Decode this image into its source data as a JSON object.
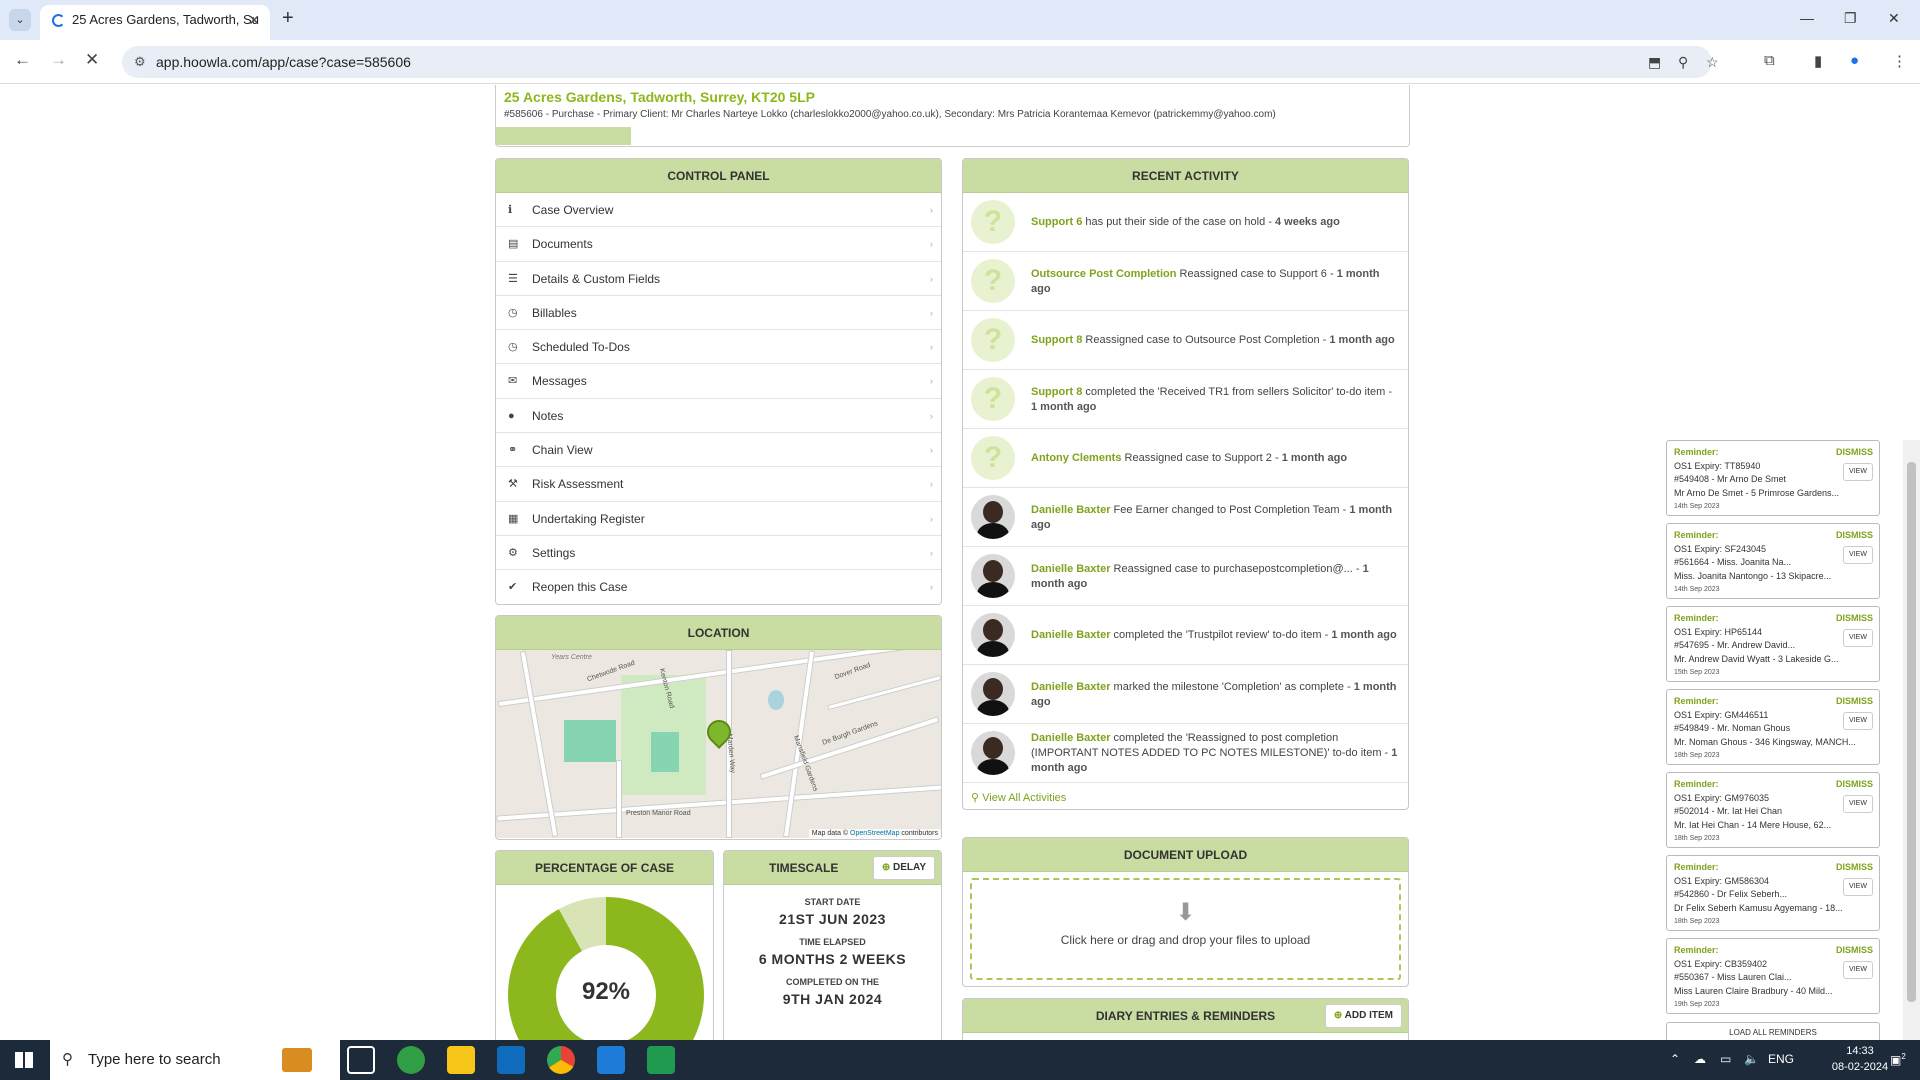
{
  "browser": {
    "tab_title": "25 Acres Gardens, Tadworth, Su",
    "url": "app.hoowla.com/app/case?case=585606"
  },
  "case": {
    "title": "25 Acres Gardens, Tadworth, Surrey, KT20 5LP",
    "subtitle": "#585606 - Purchase - Primary Client: Mr Charles Narteye Lokko (charleslokko2000@yahoo.co.uk), Secondary: Mrs Patricia Korantemaa Kemevor (patrickemmy@yahoo.com)"
  },
  "control_panel": {
    "title": "CONTROL PANEL",
    "items": [
      {
        "label": "Case Overview",
        "icon": "info-icon"
      },
      {
        "label": "Documents",
        "icon": "document-icon"
      },
      {
        "label": "Details & Custom Fields",
        "icon": "list-icon"
      },
      {
        "label": "Billables",
        "icon": "clock-icon"
      },
      {
        "label": "Scheduled To-Dos",
        "icon": "clock-icon"
      },
      {
        "label": "Messages",
        "icon": "envelope-icon"
      },
      {
        "label": "Notes",
        "icon": "comment-icon"
      },
      {
        "label": "Chain View",
        "icon": "link-icon"
      },
      {
        "label": "Risk Assessment",
        "icon": "gavel-icon"
      },
      {
        "label": "Undertaking Register",
        "icon": "register-icon"
      },
      {
        "label": "Settings",
        "icon": "gear-icon"
      },
      {
        "label": "Reopen this Case",
        "icon": "check-icon"
      }
    ]
  },
  "recent_activity": {
    "title": "RECENT ACTIVITY",
    "items": [
      {
        "who": "Support 6",
        "text": " has put their side of the case on hold - ",
        "when": "4 weeks ago",
        "photo": false
      },
      {
        "who": "Outsource Post Completion",
        "text": " Reassigned case to Support 6 - ",
        "when": "1 month ago",
        "photo": false
      },
      {
        "who": "Support 8",
        "text": " Reassigned case to Outsource Post Completion - ",
        "when": "1 month ago",
        "photo": false
      },
      {
        "who": "Support 8",
        "text": " completed the 'Received TR1 from sellers Solicitor' to-do item - ",
        "when": "1 month ago",
        "photo": false
      },
      {
        "who": "Antony Clements",
        "text": " Reassigned case to Support 2 - ",
        "when": "1 month ago",
        "photo": false
      },
      {
        "who": "Danielle Baxter",
        "text": " Fee Earner changed to Post Completion Team - ",
        "when": "1 month ago",
        "photo": true
      },
      {
        "who": "Danielle Baxter",
        "text": " Reassigned case to purchasepostcompletion@... - ",
        "when": "1 month ago",
        "photo": true
      },
      {
        "who": "Danielle Baxter",
        "text": " completed the 'Trustpilot review' to-do item - ",
        "when": "1 month ago",
        "photo": true
      },
      {
        "who": "Danielle Baxter",
        "text": " marked the milestone 'Completion' as complete - ",
        "when": "1 month ago",
        "photo": true
      },
      {
        "who": "Danielle Baxter",
        "text": " completed the 'Reassigned to post completion (IMPORTANT NOTES ADDED TO PC NOTES MILESTONE)' to-do item - ",
        "when": "1 month ago",
        "photo": true
      }
    ],
    "view_all": "View All Activities"
  },
  "location": {
    "title": "LOCATION",
    "attribution_prefix": "Map data ©",
    "attribution_link": "OpenStreetMap",
    "attribution_suffix": "contributors",
    "labels": [
      "Years Centre",
      "Chetwode Road",
      "Kenton Road",
      "Dover Road",
      "De Burgh Gardens",
      "Preston Manor Road",
      "Marden Way",
      "Mansfield Gardens"
    ]
  },
  "percentage": {
    "title": "PERCENTAGE OF CASE",
    "label": "92%",
    "value": 92
  },
  "timescale": {
    "title": "TIMESCALE",
    "delay_label": "DELAY",
    "start_label": "START DATE",
    "start_value": "21ST JUN 2023",
    "elapsed_label": "TIME ELAPSED",
    "elapsed_value": "6 MONTHS 2 WEEKS",
    "completed_label": "COMPLETED ON THE",
    "completed_value": "9TH JAN 2024"
  },
  "document_upload": {
    "title": "DOCUMENT UPLOAD",
    "hint": "Click here or drag and drop your files to upload"
  },
  "diary": {
    "title": "DIARY ENTRIES & REMINDERS",
    "add_label": "ADD ITEM"
  },
  "reminders": {
    "label": "Reminder:",
    "dismiss": "DISMISS",
    "view": "VIEW",
    "load_all": "LOAD ALL REMINDERS",
    "items": [
      {
        "l1": "OS1 Expiry: TT85940",
        "l2": "#549408 - Mr Arno De Smet",
        "l3": "Mr Arno De Smet - 5 Primrose Gardens...",
        "date": "14th Sep 2023"
      },
      {
        "l1": "OS1 Expiry: SF243045",
        "l2": "#561664 - Miss. Joanita Na...",
        "l3": "Miss. Joanita Nantongo - 13 Skipacre...",
        "date": "14th Sep 2023"
      },
      {
        "l1": "OS1 Expiry: HP65144",
        "l2": "#547695 - Mr. Andrew David...",
        "l3": "Mr. Andrew David Wyatt - 3 Lakeside G...",
        "date": "15th Sep 2023"
      },
      {
        "l1": "OS1 Expiry: GM446511",
        "l2": "#549849 - Mr. Noman Ghous",
        "l3": "Mr. Noman Ghous - 346 Kingsway, MANCH...",
        "date": "18th Sep 2023"
      },
      {
        "l1": "OS1 Expiry: GM976035",
        "l2": "#502014 - Mr. Iat Hei Chan",
        "l3": "Mr. Iat Hei Chan - 14 Mere House, 62...",
        "date": "18th Sep 2023"
      },
      {
        "l1": "OS1 Expiry: GM586304",
        "l2": "#542860 - Dr Felix Seberh...",
        "l3": "Dr Felix Seberh Kamusu Agyemang - 18...",
        "date": "18th Sep 2023"
      },
      {
        "l1": "OS1 Expiry: CB359402",
        "l2": "#550367 - Miss Lauren Clai...",
        "l3": "Miss Lauren Claire Bradbury - 40 Mild...",
        "date": "19th Sep 2023"
      }
    ]
  },
  "taskbar": {
    "search_placeholder": "Type here to search",
    "language": "ENG",
    "time": "14:33",
    "date": "08-02-2024",
    "notification_count": "2"
  },
  "colors": {
    "accent": "#8cb81e",
    "panel_header": "#c9dca1",
    "donut_pale": "#d8e4b6"
  }
}
